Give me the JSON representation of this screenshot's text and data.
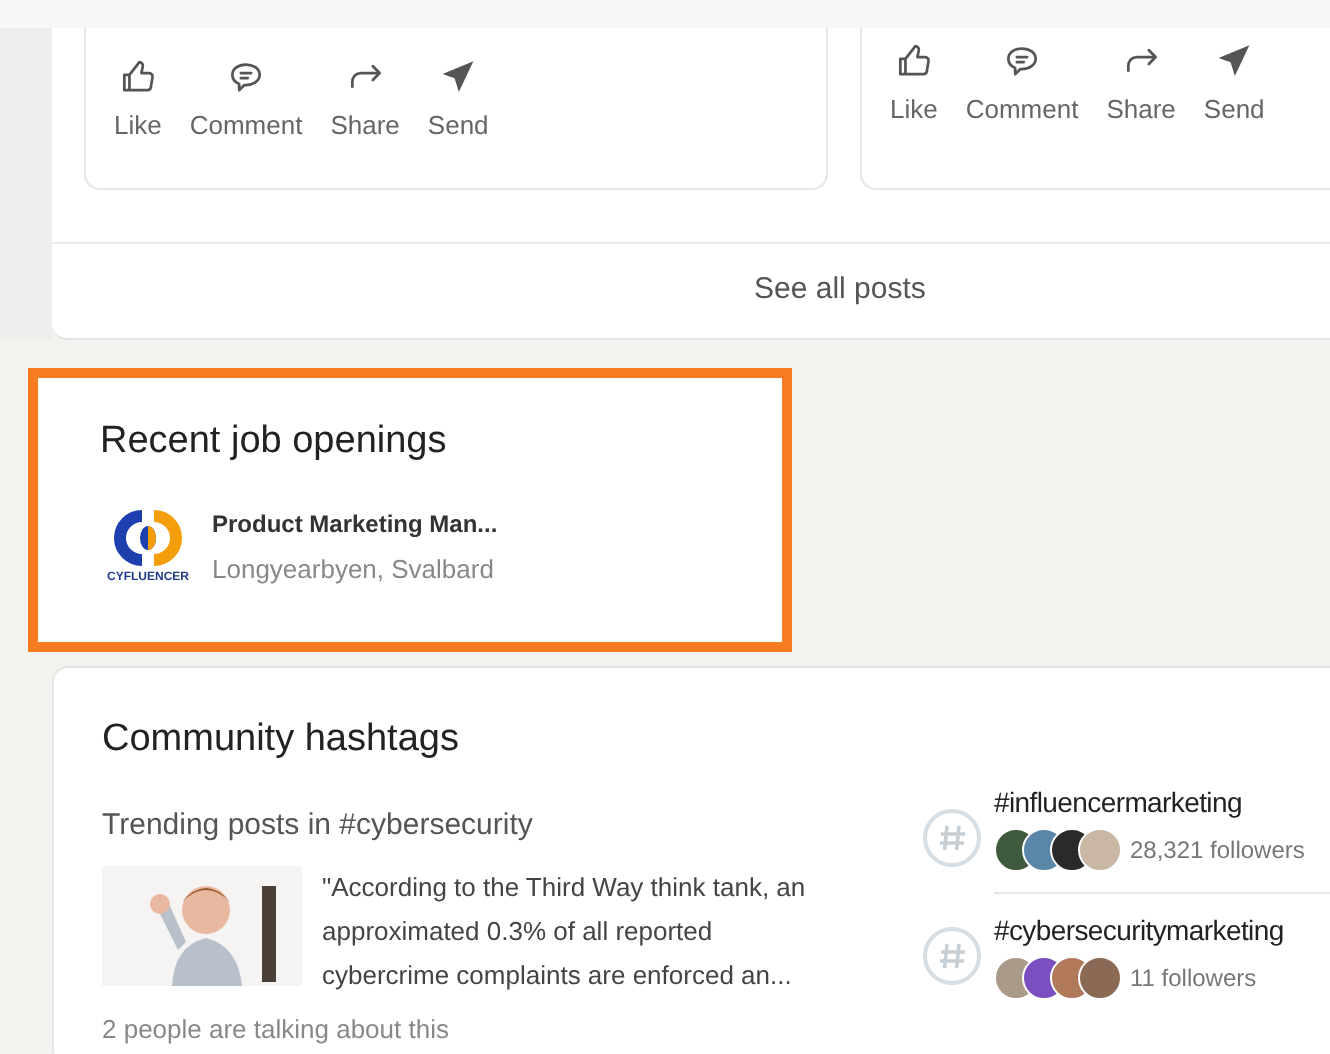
{
  "posts": [
    {
      "actions": [
        {
          "kind": "like",
          "label": "Like"
        },
        {
          "kind": "comment",
          "label": "Comment"
        },
        {
          "kind": "share",
          "label": "Share"
        },
        {
          "kind": "send",
          "label": "Send"
        }
      ]
    },
    {
      "actions": [
        {
          "kind": "like",
          "label": "Like"
        },
        {
          "kind": "comment",
          "label": "Comment"
        },
        {
          "kind": "share",
          "label": "Share"
        },
        {
          "kind": "send",
          "label": "Send"
        }
      ]
    }
  ],
  "see_all": "See all posts",
  "jobs": {
    "title": "Recent job openings",
    "highlighted": true,
    "items": [
      {
        "logo_text": "CYFLUENCER",
        "title": "Product Marketing Man...",
        "location": "Longyearbyen, Svalbard"
      }
    ]
  },
  "hashtags": {
    "title": "Community hashtags",
    "trending_label": "Trending posts in #cybersecurity",
    "post": {
      "text": "\"According to the Third Way think tank, an approximated 0.3% of all reported cybercrime complaints are enforced an...",
      "talking": "2 people are talking about this"
    },
    "items": [
      {
        "name": "#influencermarketing",
        "followers": "28,321 followers",
        "avatars": [
          {
            "color": "#3f5a3c"
          },
          {
            "color": "#5a86a8"
          },
          {
            "color": "#2a2a2a"
          },
          {
            "color": "#c9b7a4"
          }
        ]
      },
      {
        "name": "#cybersecuritymarketing",
        "followers": "11 followers",
        "avatars": [
          {
            "color": "#a99a8a"
          },
          {
            "color": "#7b4fc0"
          },
          {
            "color": "#b07a5a"
          },
          {
            "color": "#8a6a55"
          }
        ]
      }
    ]
  }
}
